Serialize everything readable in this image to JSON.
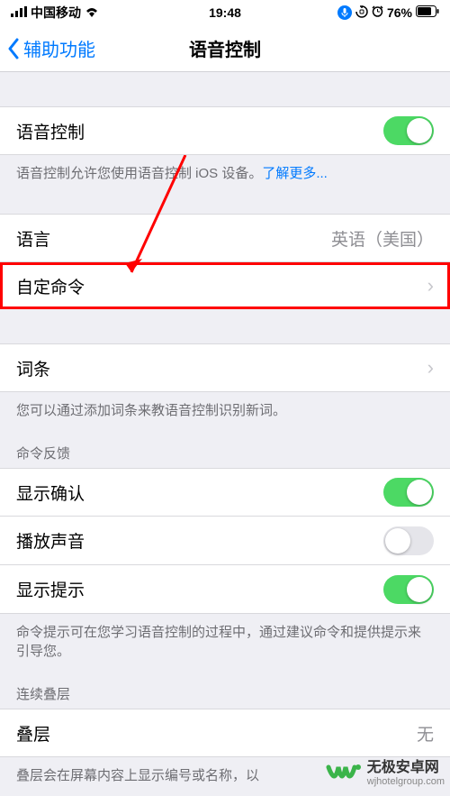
{
  "status": {
    "carrier": "中国移动",
    "time": "19:48",
    "battery": "76%"
  },
  "nav": {
    "back": "辅助功能",
    "title": "语音控制"
  },
  "voice_control": {
    "label": "语音控制",
    "enabled": true,
    "desc_prefix": "语音控制允许您使用语音控制 iOS 设备。",
    "desc_link": "了解更多..."
  },
  "language": {
    "label": "语言",
    "value": "英语（美国）"
  },
  "custom_commands": {
    "label": "自定命令"
  },
  "vocabulary": {
    "label": "词条",
    "desc": "您可以通过添加词条来教语音控制识别新词。"
  },
  "feedback": {
    "header": "命令反馈",
    "show_confirm": {
      "label": "显示确认",
      "on": true
    },
    "play_sound": {
      "label": "播放声音",
      "on": false
    },
    "show_hints": {
      "label": "显示提示",
      "on": true
    },
    "desc": "命令提示可在您学习语音控制的过程中，通过建议命令和提供提示来引导您。"
  },
  "overlay": {
    "header": "连续叠层",
    "label": "叠层",
    "value": "无",
    "desc": "叠层会在屏幕内容上显示编号或名称，以"
  },
  "watermark": {
    "title": "无极安卓网",
    "url": "wjhotelgroup.com"
  }
}
